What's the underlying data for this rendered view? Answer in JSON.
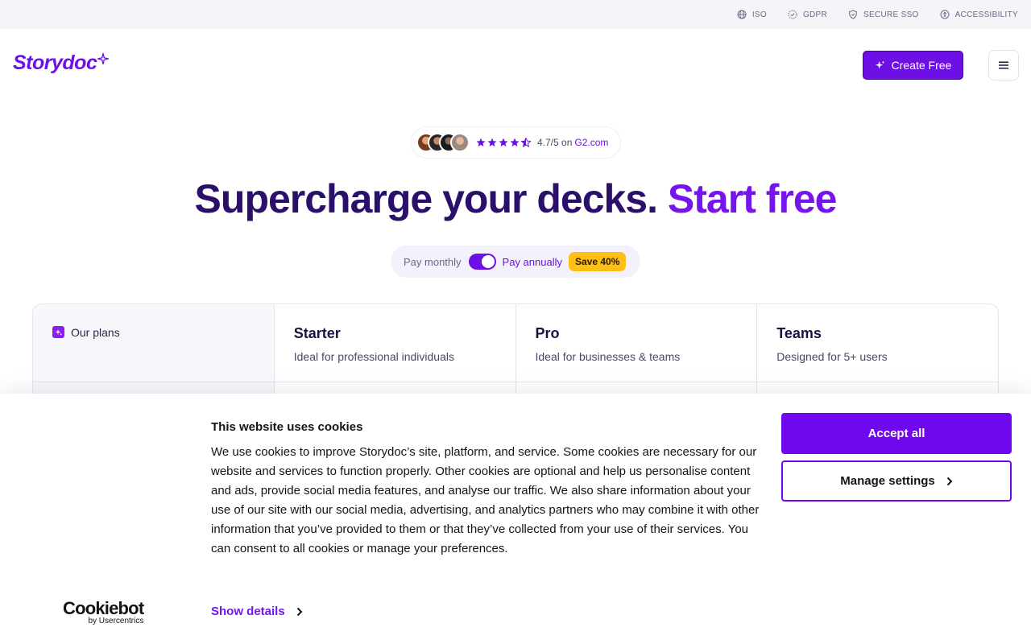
{
  "trust_bar": {
    "items": [
      {
        "icon": "globe-icon",
        "label": "ISO"
      },
      {
        "icon": "gdpr-icon",
        "label": "GDPR"
      },
      {
        "icon": "shield-icon",
        "label": "SECURE SSO"
      },
      {
        "icon": "accessibility-icon",
        "label": "ACCESSIBILITY"
      }
    ]
  },
  "header": {
    "logo_text": "Storydoc",
    "create_button": "Create Free",
    "menu_icon": "hamburger-icon"
  },
  "rating": {
    "avatar_count": 4,
    "stars": 4.5,
    "text": "4.7/5 on",
    "link": "G2.com"
  },
  "hero": {
    "title_main": "Supercharge your decks.",
    "title_accent": "Start free"
  },
  "billing": {
    "monthly_label": "Pay monthly",
    "annual_label": "Pay annually",
    "annual_selected": true,
    "save_badge": "Save 40%"
  },
  "plans": {
    "header_label": "Our plans",
    "columns": [
      {
        "name": "Starter",
        "description": "Ideal for professional individuals"
      },
      {
        "name": "Pro",
        "description": "Ideal for businesses & teams"
      },
      {
        "name": "Teams",
        "description": "Designed for 5+ users"
      }
    ]
  },
  "cookie_banner": {
    "title": "This website uses cookies",
    "body": "We use cookies to improve Storydoc’s site, platform, and service. Some cookies are necessary for our website and services to function properly. Other cookies are optional and help us personalise content and ads, provide social media features, and analyse our traffic. We also share information about your use of our site with our social media, advertising, and analytics partners who may combine it with other information that you’ve provided to them or that they’ve collected from your use of their services. You can consent to all cookies or manage your preferences.",
    "show_details": "Show details",
    "accept_all": "Accept all",
    "manage_settings": "Manage settings",
    "brand_main": "Cookiebot",
    "brand_sub": "by Usercentrics"
  },
  "colors": {
    "brand_purple": "#6d10e6",
    "hero_dark": "#2a0f6b",
    "badge_yellow": "#ffbf14"
  }
}
